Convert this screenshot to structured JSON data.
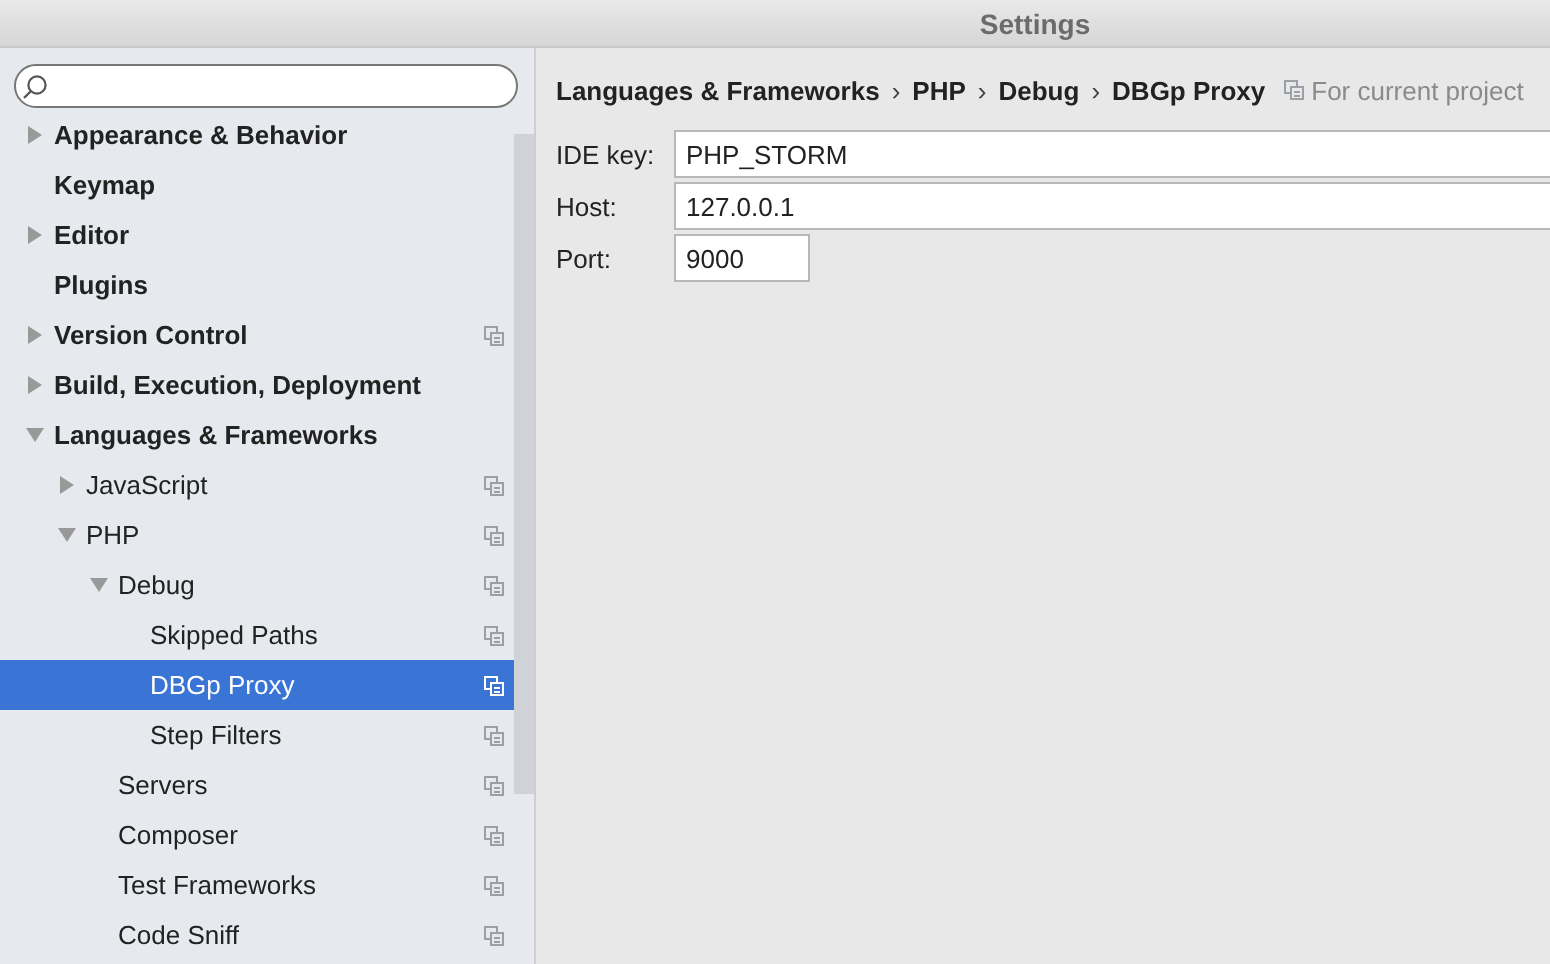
{
  "window": {
    "title": "Settings"
  },
  "sidebar": {
    "items": [
      {
        "label": "Appearance & Behavior",
        "expanded": false,
        "project_scope": false,
        "selected": false
      },
      {
        "label": "Keymap",
        "project_scope": false,
        "selected": false
      },
      {
        "label": "Editor",
        "expanded": false,
        "project_scope": false,
        "selected": false
      },
      {
        "label": "Plugins",
        "project_scope": false,
        "selected": false
      },
      {
        "label": "Version Control",
        "expanded": false,
        "project_scope": true,
        "selected": false
      },
      {
        "label": "Build, Execution, Deployment",
        "expanded": false,
        "project_scope": false,
        "selected": false
      },
      {
        "label": "Languages & Frameworks",
        "expanded": true,
        "project_scope": false,
        "selected": false,
        "children": [
          {
            "label": "JavaScript",
            "expanded": false,
            "project_scope": true,
            "selected": false
          },
          {
            "label": "PHP",
            "expanded": true,
            "project_scope": true,
            "selected": false,
            "children": [
              {
                "label": "Debug",
                "expanded": true,
                "project_scope": true,
                "selected": false,
                "children": [
                  {
                    "label": "Skipped Paths",
                    "project_scope": true,
                    "selected": false
                  },
                  {
                    "label": "DBGp Proxy",
                    "project_scope": true,
                    "selected": true
                  },
                  {
                    "label": "Step Filters",
                    "project_scope": true,
                    "selected": false
                  }
                ]
              },
              {
                "label": "Servers",
                "project_scope": true,
                "selected": false
              },
              {
                "label": "Composer",
                "project_scope": true,
                "selected": false
              },
              {
                "label": "Test Frameworks",
                "project_scope": true,
                "selected": false
              },
              {
                "label": "Code Sniff",
                "project_scope": true,
                "selected": false
              }
            ]
          }
        ]
      }
    ]
  },
  "breadcrumb": [
    "Languages & Frameworks",
    "PHP",
    "Debug",
    "DBGp Proxy"
  ],
  "breadcrumb_separator": "›",
  "scope_note": "For current project",
  "fields": [
    {
      "label": "IDE key:",
      "value": "PHP_STORM",
      "kind": "wide"
    },
    {
      "label": "Host:",
      "value": "127.0.0.1",
      "kind": "wide"
    },
    {
      "label": "Port:",
      "value": "9000",
      "kind": "short"
    }
  ]
}
